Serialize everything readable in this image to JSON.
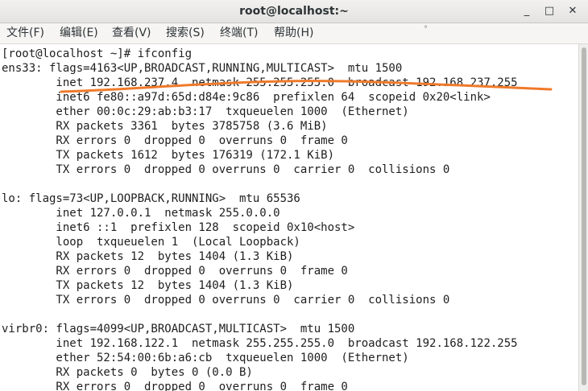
{
  "window": {
    "title": "root@localhost:~",
    "minimize_glyph": "_",
    "maximize_glyph": "□",
    "close_glyph": "✕"
  },
  "menu": {
    "items": [
      "文件(F)",
      "编辑(E)",
      "查看(V)",
      "搜索(S)",
      "终端(T)",
      "帮助(H)"
    ],
    "indicator_glyph": "°"
  },
  "terminal": {
    "lines": [
      "[root@localhost ~]# ifconfig",
      "ens33: flags=4163<UP,BROADCAST,RUNNING,MULTICAST>  mtu 1500",
      "        inet 192.168.237.4  netmask 255.255.255.0  broadcast 192.168.237.255",
      "        inet6 fe80::a97d:65d:d84e:9c86  prefixlen 64  scopeid 0x20<link>",
      "        ether 00:0c:29:ab:b3:17  txqueuelen 1000  (Ethernet)",
      "        RX packets 3361  bytes 3785758 (3.6 MiB)",
      "        RX errors 0  dropped 0  overruns 0  frame 0",
      "        TX packets 1612  bytes 176319 (172.1 KiB)",
      "        TX errors 0  dropped 0 overruns 0  carrier 0  collisions 0",
      "",
      "lo: flags=73<UP,LOOPBACK,RUNNING>  mtu 65536",
      "        inet 127.0.0.1  netmask 255.0.0.0",
      "        inet6 ::1  prefixlen 128  scopeid 0x10<host>",
      "        loop  txqueuelen 1  (Local Loopback)",
      "        RX packets 12  bytes 1404 (1.3 KiB)",
      "        RX errors 0  dropped 0  overruns 0  frame 0",
      "        TX packets 12  bytes 1404 (1.3 KiB)",
      "        TX errors 0  dropped 0 overruns 0  carrier 0  collisions 0",
      "",
      "virbr0: flags=4099<UP,BROADCAST,MULTICAST>  mtu 1500",
      "        inet 192.168.122.1  netmask 255.255.255.0  broadcast 192.168.122.255",
      "        ether 52:54:00:6b:a6:cb  txqueuelen 1000  (Ethernet)",
      "        RX packets 0  bytes 0 (0.0 B)",
      "        RX errors 0  dropped 0  overruns 0  frame 0"
    ]
  },
  "annotation": {
    "color": "#f07a2a"
  }
}
